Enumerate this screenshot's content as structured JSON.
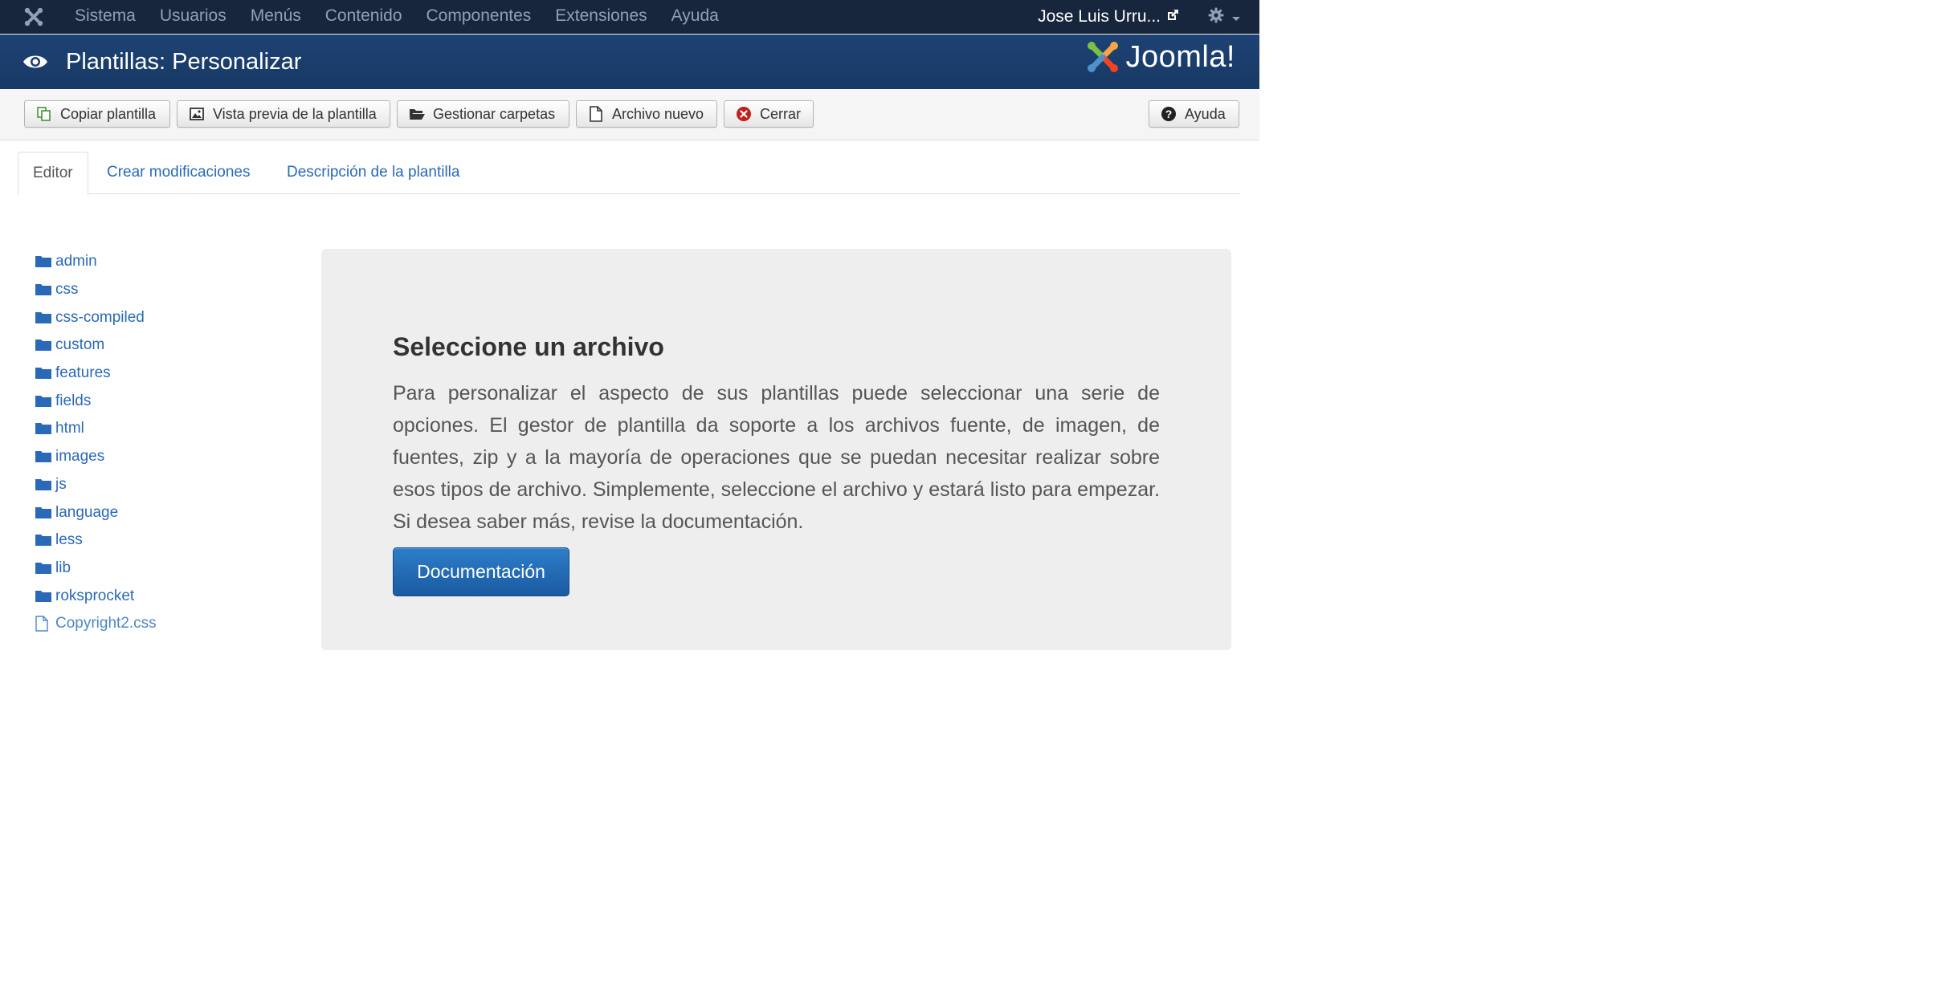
{
  "navbar": {
    "menu": [
      "Sistema",
      "Usuarios",
      "Menús",
      "Contenido",
      "Componentes",
      "Extensiones",
      "Ayuda"
    ],
    "user": "Jose Luis Urru...",
    "icons": {
      "logo": "joomla-icon",
      "external": "external-link-icon",
      "settings": "gear-icon"
    }
  },
  "header": {
    "title": "Plantillas: Personalizar",
    "brand": "Joomla!"
  },
  "toolbar": {
    "copy": "Copiar plantilla",
    "preview": "Vista previa de la plantilla",
    "folders": "Gestionar carpetas",
    "newfile": "Archivo nuevo",
    "close": "Cerrar",
    "help": "Ayuda"
  },
  "tabs": [
    "Editor",
    "Crear modificaciones",
    "Descripción de la plantilla"
  ],
  "tree": {
    "folders": [
      "admin",
      "css",
      "css-compiled",
      "custom",
      "features",
      "fields",
      "html",
      "images",
      "js",
      "language",
      "less",
      "lib",
      "roksprocket"
    ],
    "files": [
      "Copyright2.css"
    ]
  },
  "panel": {
    "title": "Seleccione un archivo",
    "text": "Para personalizar el aspecto de sus plantillas puede seleccionar una serie de opciones. El gestor de plantilla da soporte a los archivos fuente, de imagen, de fuentes, zip y a la mayoría de operaciones que se puedan necesitar realizar sobre esos tipos de archivo. Simplemente, seleccione el archivo y estará listo para empezar. Si desea saber más, revise la documentación.",
    "button": "Documentación"
  },
  "colors": {
    "navbar": "#17253d",
    "header": "#1b3d6f",
    "link": "#2a69b8",
    "primary_button": "#1f63aa"
  }
}
